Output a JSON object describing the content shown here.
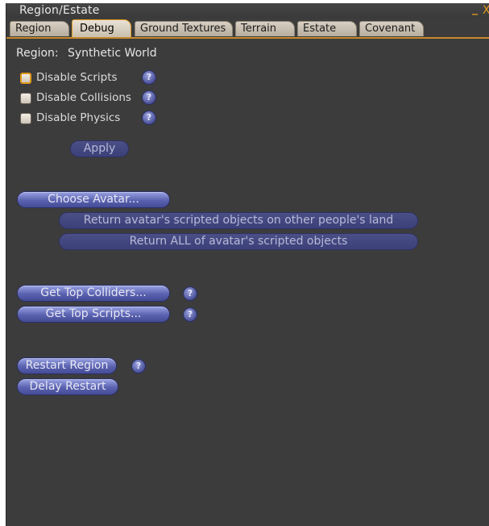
{
  "window": {
    "title": "Region/Estate",
    "minimize_glyph": "_",
    "close_glyph": "X"
  },
  "tabs": [
    {
      "label": "Region",
      "active": false
    },
    {
      "label": "Debug",
      "active": true
    },
    {
      "label": "Ground Textures",
      "active": false
    },
    {
      "label": "Terrain",
      "active": false
    },
    {
      "label": "Estate",
      "active": false
    },
    {
      "label": "Covenant",
      "active": false
    }
  ],
  "region": {
    "label": "Region:",
    "name": "Synthetic World"
  },
  "options": [
    {
      "label": "Disable Scripts",
      "checked": false
    },
    {
      "label": "Disable Collisions",
      "checked": false
    },
    {
      "label": "Disable Physics",
      "checked": false
    }
  ],
  "help_glyph": "?",
  "buttons": {
    "apply": "Apply",
    "choose_avatar": "Choose Avatar...",
    "return_other_land": "Return avatar's scripted objects on other people's land",
    "return_all": "Return ALL of avatar's scripted objects",
    "top_colliders": "Get Top Colliders...",
    "top_scripts": "Get Top Scripts...",
    "restart_region": "Restart Region",
    "delay_restart": "Delay Restart"
  },
  "colors": {
    "panel_bg": "#3c3c3c",
    "accent": "#e09a1e",
    "button": "#5a62b0"
  }
}
